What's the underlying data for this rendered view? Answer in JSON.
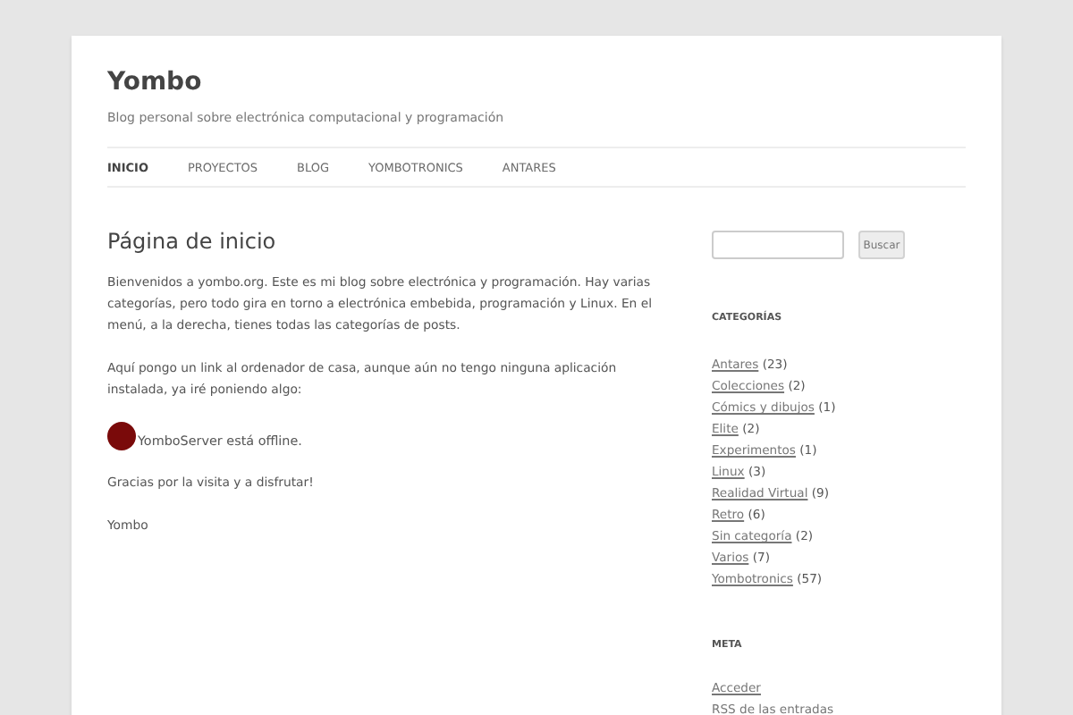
{
  "site": {
    "title": "Yombo",
    "tagline": "Blog personal sobre electrónica computacional y programación"
  },
  "nav": [
    {
      "label": "INICIO",
      "selected": true
    },
    {
      "label": "PROYECTOS",
      "selected": false
    },
    {
      "label": "BLOG",
      "selected": false
    },
    {
      "label": "YOMBOTRONICS",
      "selected": false
    },
    {
      "label": "ANTARES",
      "selected": false
    }
  ],
  "page": {
    "heading": "Página de inicio",
    "paragraphs": [
      "Bienvenidos a yombo.org. Este es mi blog sobre electrónica y programación. Hay varias categorías, pero todo gira en torno a electrónica embebida, programación y Linux. En el menú, a la derecha, tienes todas las categorías de posts.",
      "Aquí pongo un link al ordenador de casa, aunque aún no tengo ninguna aplicación instalada, ya iré poniendo algo:"
    ],
    "server_status": "YomboServer está offline.",
    "closing": [
      "Gracias por la visita y a disfrutar!",
      "Yombo"
    ]
  },
  "sidebar": {
    "search_button": "Buscar",
    "categories_title": "CATEGORÍAS",
    "categories": [
      {
        "name": "Antares",
        "count": "(23)"
      },
      {
        "name": "Colecciones",
        "count": "(2)"
      },
      {
        "name": "Cómics y dibujos",
        "count": "(1)"
      },
      {
        "name": "Elite",
        "count": "(2)"
      },
      {
        "name": "Experimentos",
        "count": "(1)"
      },
      {
        "name": "Linux",
        "count": "(3)"
      },
      {
        "name": "Realidad Virtual",
        "count": "(9)"
      },
      {
        "name": "Retro",
        "count": "(6)"
      },
      {
        "name": "Sin categoría",
        "count": "(2)"
      },
      {
        "name": "Varios",
        "count": "(7)"
      },
      {
        "name": "Yombotronics",
        "count": "(57)"
      }
    ],
    "meta_title": "META",
    "meta": [
      "Acceder",
      "RSS de las entradas"
    ]
  }
}
